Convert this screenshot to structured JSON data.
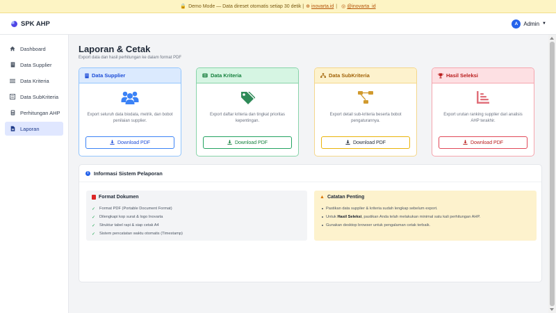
{
  "banner": {
    "text": "Demo Mode — Data direset otomatis setiap 30 detik |",
    "link1": "inovarta.id",
    "separator": "|",
    "link2": "@inovarta_id"
  },
  "navbar": {
    "brand": "SPK AHP",
    "avatar_initial": "A",
    "user_label": "Admin"
  },
  "sidebar": {
    "items": [
      {
        "label": "Dashboard",
        "icon": "home-icon"
      },
      {
        "label": "Data Supplier",
        "icon": "building-icon"
      },
      {
        "label": "Data Kriteria",
        "icon": "list-icon"
      },
      {
        "label": "Data SubKriteria",
        "icon": "tasks-icon"
      },
      {
        "label": "Perhitungan AHP",
        "icon": "calculator-icon"
      },
      {
        "label": "Laporan",
        "icon": "file-icon",
        "active": true
      }
    ]
  },
  "page": {
    "title": "Laporan & Cetak",
    "subtitle": "Export data dan hasil perhitungan ke dalam format PDF"
  },
  "cards": [
    {
      "title": "Data Supplier",
      "desc": "Export seluruh data biodata, metrik, dan bobot penilaian supplier.",
      "button": "Download PDF",
      "color": "#3b82f6"
    },
    {
      "title": "Data Kriteria",
      "desc": "Export daftar kriteria dan tingkat prioritas kepentingan.",
      "button": "Download PDF",
      "color": "#22a360"
    },
    {
      "title": "Data SubKriteria",
      "desc": "Export detail sub-kriteria beserta bobot pengaturannya.",
      "button": "Download PDF",
      "color": "#eab308"
    },
    {
      "title": "Hasil Seleksi",
      "desc": "Export urutan ranking supplier dari analisis AHP terakhir.",
      "button": "Download PDF",
      "color": "#e04757"
    }
  ],
  "info": {
    "title": "Informasi Sistem Pelaporan",
    "format": {
      "title": "Format Dokumen",
      "items": [
        "Format PDF (Portable Document Format)",
        "Dilengkapi kop surat & logo Inovarta",
        "Struktur tabel rapi & siap cetak A4",
        "Sistem pencatatan waktu otomatis (Timestamp)"
      ]
    },
    "notes": {
      "title": "Catatan Penting",
      "item1": "Pastikan data supplier & kriteria sudah lengkap sebelum export.",
      "item2_pre": "Untuk",
      "item2_bold": "Hasil Seleksi",
      "item2_post": ", pastikan Anda telah melakukan minimal satu kali perhitungan AHP.",
      "item3": "Gunakan desktop browser untuk pengalaman cetak terbaik."
    }
  }
}
